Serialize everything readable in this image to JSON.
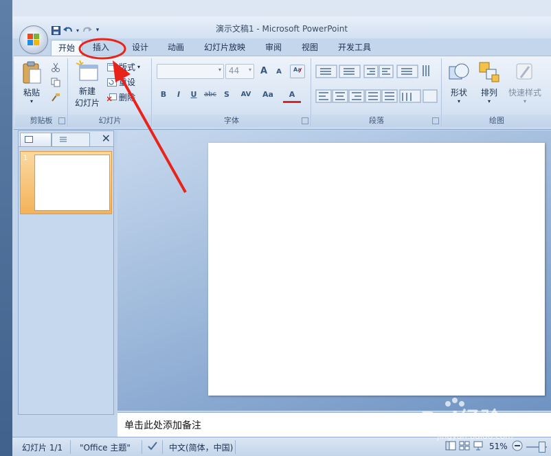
{
  "app": {
    "title": "演示文稿1 - Microsoft PowerPoint"
  },
  "tabs": [
    "开始",
    "插入",
    "设计",
    "动画",
    "幻灯片放映",
    "审阅",
    "视图",
    "开发工具"
  ],
  "ribbon": {
    "clipboard": {
      "paste": "粘贴",
      "label": "剪贴板"
    },
    "slides": {
      "new_slide_line1": "新建",
      "new_slide_line2": "幻灯片",
      "layout": "版式",
      "reset": "重设",
      "delete": "删除",
      "label": "幻灯片"
    },
    "font": {
      "size": "44",
      "label": "字体",
      "bold": "B",
      "italic": "I",
      "underline": "U",
      "strike": "abc",
      "shadow": "S",
      "spacing": "AV",
      "case": "Aa",
      "grow": "A",
      "shrink": "A",
      "color": "A"
    },
    "paragraph": {
      "label": "段落"
    },
    "drawing": {
      "shapes": "形状",
      "arrange": "排列",
      "quick_styles": "快速样式",
      "label": "绘图"
    }
  },
  "panel": {
    "slide_number": "1"
  },
  "notes": {
    "placeholder": "单击此处添加备注"
  },
  "status": {
    "slide_info": "幻灯片 1/1",
    "theme": "\"Office 主题\"",
    "language": "中文(简体，中国)",
    "zoom": "51%"
  },
  "watermark": {
    "brand": "Bai经验",
    "url": "jingyan.baidu.com"
  },
  "colors": {
    "annotation_red": "#e8231b",
    "ribbon_blue": "#c4d6ec"
  }
}
